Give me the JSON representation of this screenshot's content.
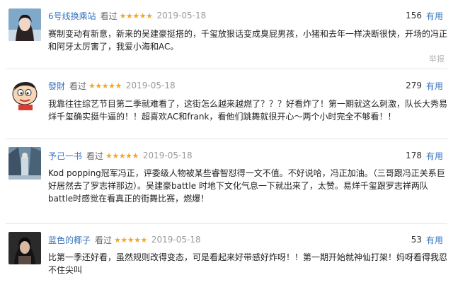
{
  "reviews": [
    {
      "username": "6号线换乘站",
      "watched": "看过",
      "rating": "★★★★★",
      "date": "2019-05-18",
      "useful_count": "156",
      "useful_label": "有用",
      "lines": [
        "赛制变动有新意，新来的吴建豪挺搭的，千玺放狠话变成臭屁男孩，小猪和去年一样决断很快，开场的冯正",
        "和阿牙太厉害了，我爱小海和AC。"
      ],
      "report": "举报"
    },
    {
      "username": "發財",
      "watched": "看过",
      "rating": "★★★★★",
      "date": "2019-05-18",
      "useful_count": "279",
      "useful_label": "有用",
      "lines": [
        "我靠往往综艺节目第二季就难看了，这街怎么越来越燃了？？？好看炸了！第一期就这么刺激，队长大秀易",
        "烊千玺确实挺牛逼的！！超喜欢AC和frank，看他们跳舞就很开心～两个小时完全不够看！！"
      ]
    },
    {
      "username": "予己一书",
      "watched": "看过",
      "rating": "★★★★★",
      "date": "2019-05-18",
      "useful_count": "178",
      "useful_label": "有用",
      "lines": [
        "Kod popping冠军冯正，评委级人物被某些睿智怼得一文不值。不好说哈，冯正加油。（三哥跟冯正关系巨",
        "好居然去了罗志祥那边）。吴建豪battle 时地下文化气息一下就出来了，太赞。易烊千玺跟罗志祥两队",
        "battle时感觉在看真正的街舞比赛，燃爆！"
      ]
    },
    {
      "username": "蓝色的椰子",
      "watched": "看过",
      "rating": "★★★★★",
      "date": "2019-05-18",
      "useful_count": "53",
      "useful_label": "有用",
      "lines": [
        "比第一季还好看，虽然规则改得变态，可是看起来好带感好炸呀！！第一期开始就神仙打架！妈呀看得我忍",
        "不住尖叫"
      ]
    }
  ]
}
